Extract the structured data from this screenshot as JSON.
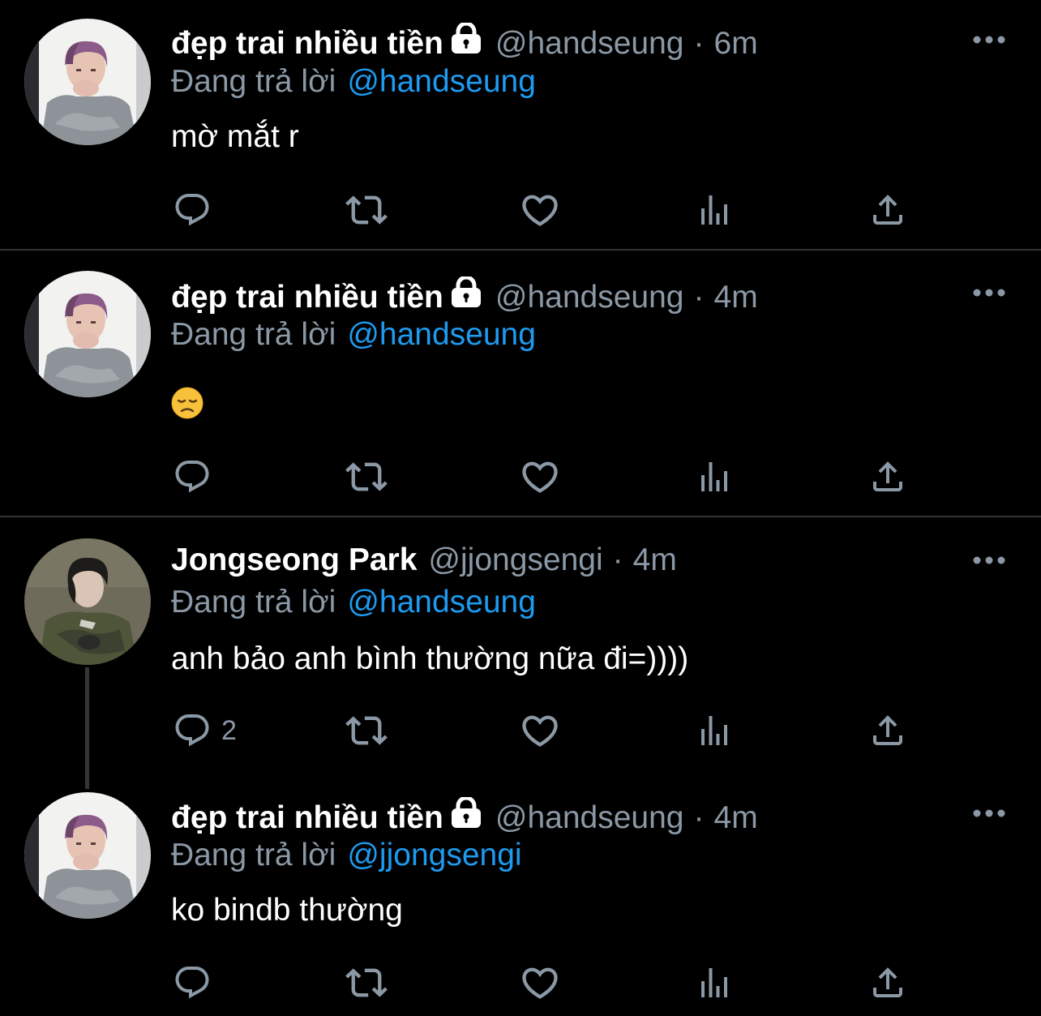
{
  "colors": {
    "background": "#000000",
    "name": "#ffffff",
    "secondary_text": "#8b98a5",
    "link": "#1d9bf0",
    "divider": "#2f3336"
  },
  "tweets": [
    {
      "name": "đẹp trai nhiều tiền",
      "locked": true,
      "handle": "@handseung",
      "separator": "·",
      "time": "6m",
      "replying_label": "Đang trả lời",
      "replying_to": "@handseung",
      "text": "mờ mắt r",
      "reply_count": "",
      "icons": [
        "reply-icon",
        "retweet-icon",
        "like-icon",
        "analytics-icon",
        "share-icon",
        "more-icon"
      ]
    },
    {
      "name": "đẹp trai nhiều tiền",
      "locked": true,
      "handle": "@handseung",
      "separator": "·",
      "time": "4m",
      "replying_label": "Đang trả lời",
      "replying_to": "@handseung",
      "text": "",
      "emoji": "disappointed-face-emoji",
      "reply_count": "",
      "icons": [
        "reply-icon",
        "retweet-icon",
        "like-icon",
        "analytics-icon",
        "share-icon",
        "more-icon"
      ]
    },
    {
      "name": "Jongseong Park",
      "locked": false,
      "handle": "@jjongsengi",
      "separator": "·",
      "time": "4m",
      "replying_label": "Đang trả lời",
      "replying_to": "@handseung",
      "text": "anh bảo anh bình thường nữa đi=))))",
      "reply_count": "2",
      "icons": [
        "reply-icon",
        "retweet-icon",
        "like-icon",
        "analytics-icon",
        "share-icon",
        "more-icon"
      ]
    },
    {
      "name": "đẹp trai nhiều tiền",
      "locked": true,
      "handle": "@handseung",
      "separator": "·",
      "time": "4m",
      "replying_label": "Đang trả lời",
      "replying_to": "@jjongsengi",
      "text": "ko bindb thường",
      "reply_count": "",
      "icons": [
        "reply-icon",
        "retweet-icon",
        "like-icon",
        "analytics-icon",
        "share-icon",
        "more-icon"
      ]
    }
  ]
}
